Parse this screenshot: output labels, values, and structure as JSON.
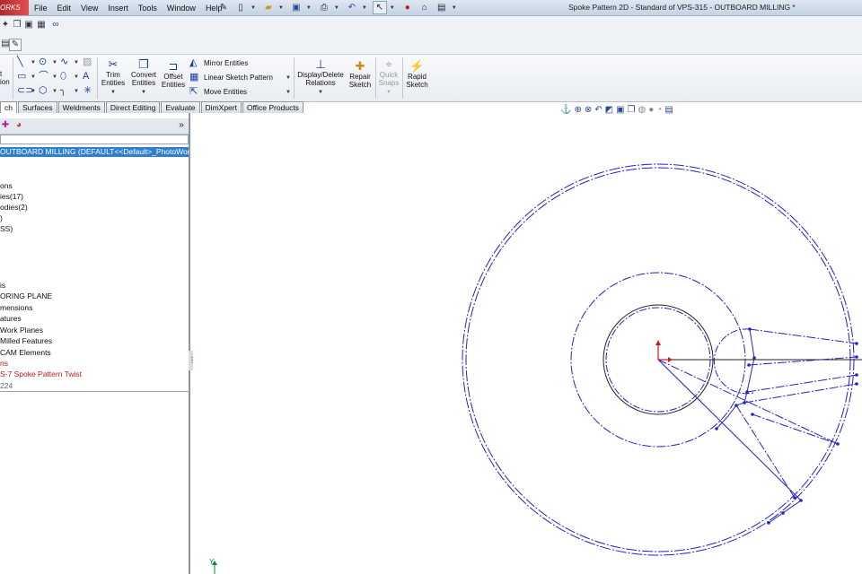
{
  "app": {
    "logo_text": "ORKS",
    "title": "Spoke Pattern 2D - Standard of VPS-315 - OUTBOARD MILLING *"
  },
  "menu": [
    "File",
    "Edit",
    "View",
    "Insert",
    "Tools",
    "Window",
    "Help"
  ],
  "ribbon": {
    "sketch_partial_top": "t",
    "sketch_partial_bottom": "ion",
    "trim": [
      "Trim",
      "Entities"
    ],
    "convert": [
      "Convert",
      "Entities"
    ],
    "offset": [
      "Offset",
      "Entities"
    ],
    "mirror": "Mirror Entities",
    "linear_pattern": "Linear Sketch Pattern",
    "move": "Move Entities",
    "display_delete": [
      "Display/Delete",
      "Relations"
    ],
    "repair": [
      "Repair",
      "Sketch"
    ],
    "quick_snaps": [
      "Quick",
      "Snaps"
    ],
    "rapid": [
      "Rapid",
      "Sketch"
    ]
  },
  "tabs": [
    {
      "label": "ch",
      "active": true
    },
    {
      "label": "Surfaces",
      "active": false
    },
    {
      "label": "Weldments",
      "active": false
    },
    {
      "label": "Direct Editing",
      "active": false
    },
    {
      "label": "Evaluate",
      "active": false
    },
    {
      "label": "DimXpert",
      "active": false
    },
    {
      "label": "Office Products",
      "active": false
    }
  ],
  "pane": {
    "collapse_label": "»",
    "tree": [
      {
        "label": "OUTBOARD MILLING  (DEFAULT<<Default>_PhotoWorks",
        "style": "sel"
      },
      {
        "label": "ons",
        "style": ""
      },
      {
        "label": "ies(17)",
        "style": ""
      },
      {
        "label": "odies(2)",
        "style": ""
      },
      {
        "label": ")",
        "style": ""
      },
      {
        "label": "SS)",
        "style": ""
      },
      {
        "label": "is",
        "style": ""
      },
      {
        "label": "ORING PLANE",
        "style": ""
      },
      {
        "label": "mensions",
        "style": ""
      },
      {
        "label": "atures",
        "style": ""
      },
      {
        "label": "Work Planes",
        "style": ""
      },
      {
        "label": "Milled Features",
        "style": ""
      },
      {
        "label": "CAM Elements",
        "style": ""
      },
      {
        "label": "ns",
        "style": "red"
      },
      {
        "label": "S-7 Spoke Pattern Twist",
        "style": "red"
      },
      {
        "label": "224",
        "style": "grey"
      }
    ]
  },
  "triad_label": "Y",
  "colors": {
    "sketch_blue": "#2323c8",
    "selection_blue": "#2f7fd0",
    "error_red": "#c01818"
  }
}
